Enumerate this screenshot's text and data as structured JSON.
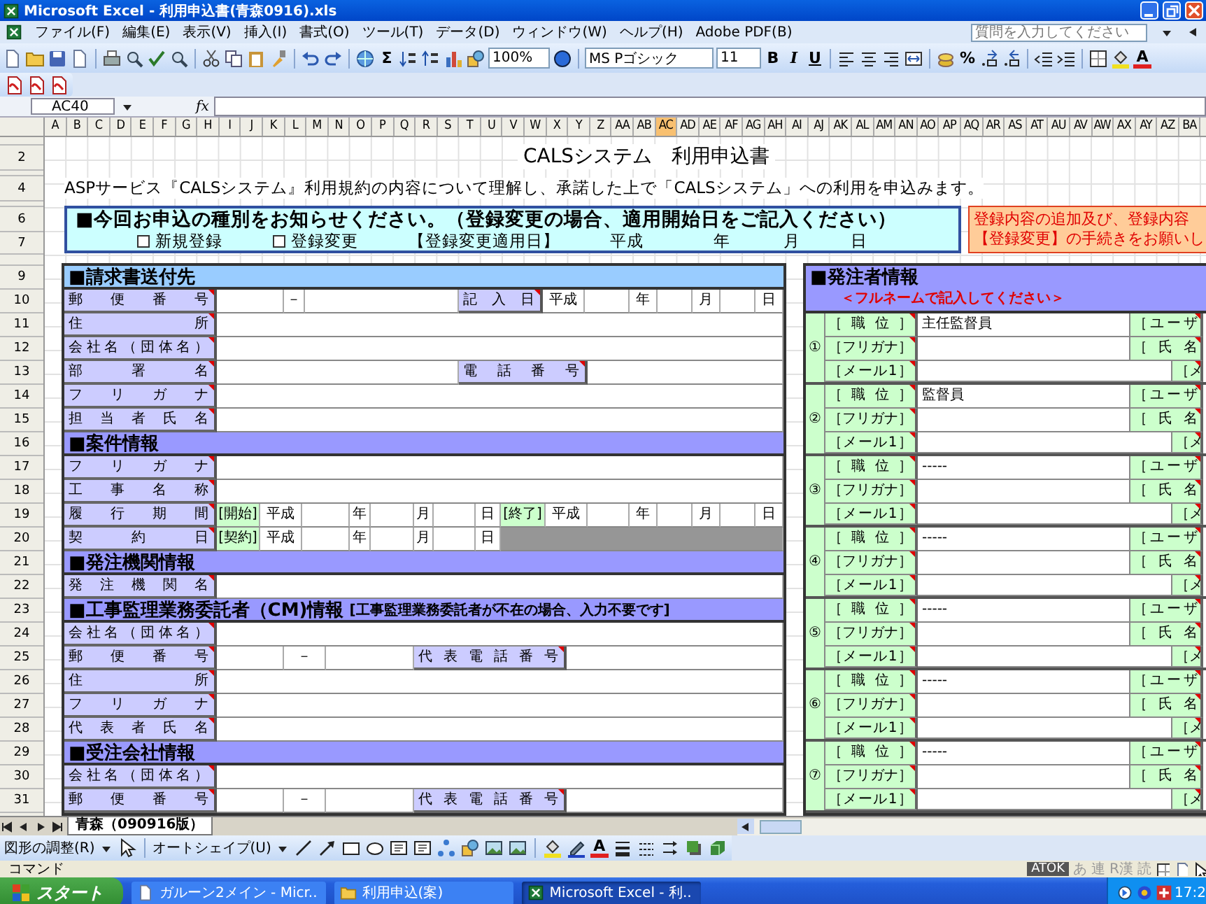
{
  "window": {
    "title": "Microsoft Excel - 利用申込書(青森0916).xls"
  },
  "menu": {
    "items": [
      "ファイル(F)",
      "編集(E)",
      "表示(V)",
      "挿入(I)",
      "書式(O)",
      "ツール(T)",
      "データ(D)",
      "ウィンドウ(W)",
      "ヘルプ(H)",
      "Adobe PDF(B)"
    ],
    "help_search": {
      "placeholder": "質問を入力してください"
    }
  },
  "toolbar": {
    "sum": "Σ",
    "zoom": "100%",
    "font": "MS Pゴシック",
    "font_size": "11",
    "bold": "B",
    "italic": "I",
    "underline": "U",
    "percent": "%",
    "font_color": "A"
  },
  "formula_bar": {
    "name_box": "AC40",
    "fx": "fx"
  },
  "columns": [
    {
      "label": "A",
      "selected": false
    },
    {
      "label": "B",
      "selected": false
    },
    {
      "label": "C",
      "selected": false
    },
    {
      "label": "D",
      "selected": false
    },
    {
      "label": "E",
      "selected": false
    },
    {
      "label": "F",
      "selected": false
    },
    {
      "label": "G",
      "selected": false
    },
    {
      "label": "H",
      "selected": false
    },
    {
      "label": "I",
      "selected": false
    },
    {
      "label": "J",
      "selected": false
    },
    {
      "label": "K",
      "selected": false
    },
    {
      "label": "L",
      "selected": false
    },
    {
      "label": "M",
      "selected": false
    },
    {
      "label": "N",
      "selected": false
    },
    {
      "label": "O",
      "selected": false
    },
    {
      "label": "P",
      "selected": false
    },
    {
      "label": "Q",
      "selected": false
    },
    {
      "label": "R",
      "selected": false
    },
    {
      "label": "S",
      "selected": false
    },
    {
      "label": "T",
      "selected": false
    },
    {
      "label": "U",
      "selected": false
    },
    {
      "label": "V",
      "selected": false
    },
    {
      "label": "W",
      "selected": false
    },
    {
      "label": "X",
      "selected": false
    },
    {
      "label": "Y",
      "selected": false
    },
    {
      "label": "Z",
      "selected": false
    },
    {
      "label": "AA",
      "selected": false
    },
    {
      "label": "AB",
      "selected": false
    },
    {
      "label": "AC",
      "selected": true
    },
    {
      "label": "AD",
      "selected": false
    },
    {
      "label": "AE",
      "selected": false
    },
    {
      "label": "AF",
      "selected": false
    },
    {
      "label": "AG",
      "selected": false
    },
    {
      "label": "AH",
      "selected": false
    },
    {
      "label": "AI",
      "selected": false
    },
    {
      "label": "AJ",
      "selected": false
    },
    {
      "label": "AK",
      "selected": false
    },
    {
      "label": "AL",
      "selected": false
    },
    {
      "label": "AM",
      "selected": false
    },
    {
      "label": "AN",
      "selected": false
    },
    {
      "label": "AO",
      "selected": false
    },
    {
      "label": "AP",
      "selected": false
    },
    {
      "label": "AQ",
      "selected": false
    },
    {
      "label": "AR",
      "selected": false
    },
    {
      "label": "AS",
      "selected": false
    },
    {
      "label": "AT",
      "selected": false
    },
    {
      "label": "AU",
      "selected": false
    },
    {
      "label": "AV",
      "selected": false
    },
    {
      "label": "AW",
      "selected": false
    },
    {
      "label": "AX",
      "selected": false
    },
    {
      "label": "AY",
      "selected": false
    },
    {
      "label": "AZ",
      "selected": false
    },
    {
      "label": "BA",
      "selected": false
    }
  ],
  "row_headers": [
    "2",
    "4",
    "6",
    "7",
    "9",
    "10",
    "11",
    "12",
    "13",
    "14",
    "15",
    "16",
    "17",
    "18",
    "19",
    "20",
    "21",
    "22",
    "23",
    "24",
    "25",
    "26",
    "27",
    "28",
    "29",
    "30",
    "31"
  ],
  "sheet": {
    "title": "CALSシステム　利用申込書",
    "agreement": "ASPサービス『CALSシステム』利用規約の内容について理解し、承諾した上で「CALSシステム」への利用を申込みます。",
    "type_box": {
      "heading": "■今回お申込の種別をお知らせください。（登録変更の場合、適用開始日をご記入ください）",
      "options": [
        {
          "label": "新規登録",
          "checked": false
        },
        {
          "label": "登録変更",
          "checked": false
        }
      ],
      "date_label": "【登録変更適用日】",
      "era": "平成",
      "year": "年",
      "month": "月",
      "day": "日"
    },
    "notice": [
      "登録内容の追加及び、登録内容",
      "【登録変更】の手続きをお願いし"
    ],
    "left_form": [
      {
        "kind": "section",
        "title": "■請求書送付先",
        "color": "#99ccff"
      },
      {
        "kind": "postal_date",
        "cells": [
          "郵便番号",
          "－",
          "記入日",
          "平成",
          "年",
          "月",
          "日"
        ]
      },
      {
        "kind": "field",
        "cells": [
          "住所"
        ]
      },
      {
        "kind": "field",
        "cells": [
          "会社名（団体名）"
        ]
      },
      {
        "kind": "field_phone",
        "cells": [
          "部署名",
          "電話番号"
        ]
      },
      {
        "kind": "field",
        "cells": [
          "フリガナ"
        ]
      },
      {
        "kind": "field",
        "cells": [
          "担当者氏名"
        ]
      },
      {
        "kind": "section",
        "title": "■案件情報",
        "color": "#9999ff"
      },
      {
        "kind": "field",
        "cells": [
          "フリガナ"
        ]
      },
      {
        "kind": "field",
        "cells": [
          "工事名称"
        ]
      },
      {
        "kind": "period",
        "cells": [
          "履行期間",
          "[開始]",
          "平成",
          "年",
          "月",
          "日",
          "[終了]",
          "平成",
          "年",
          "月",
          "日"
        ]
      },
      {
        "kind": "contract",
        "cells": [
          "契約日",
          "[契約]",
          "平成",
          "年",
          "月",
          "日"
        ]
      },
      {
        "kind": "section",
        "title": "■発注機関情報",
        "color": "#9999ff"
      },
      {
        "kind": "field",
        "cells": [
          "発注機関名"
        ]
      },
      {
        "kind": "section",
        "title": "■工事監理業務委託者（CM)情報",
        "note": "[工事監理業務委託者が不在の場合、入力不要です]",
        "color": "#9999ff"
      },
      {
        "kind": "field",
        "cells": [
          "会社名（団体名）"
        ]
      },
      {
        "kind": "postal_phone",
        "cells": [
          "郵便番号",
          "－",
          "代表電話番号"
        ]
      },
      {
        "kind": "field",
        "cells": [
          "住所"
        ]
      },
      {
        "kind": "field",
        "cells": [
          "フリガナ"
        ]
      },
      {
        "kind": "field",
        "cells": [
          "代表者氏名"
        ]
      },
      {
        "kind": "section",
        "title": "■受注会社情報",
        "color": "#9999ff"
      },
      {
        "kind": "field",
        "cells": [
          "会社名（団体名）"
        ]
      },
      {
        "kind": "postal_phone",
        "cells": [
          "郵便番号",
          "－",
          "代表電話番号"
        ]
      }
    ],
    "orderer": {
      "title": "■発注者情報",
      "note": "＜フルネームで記入してください＞",
      "members": [
        {
          "number": "①",
          "position_label": "［職位］",
          "position": "主任監督員",
          "user_label": "［ユーザ",
          "kana_label": "［フリガナ］",
          "name_label": "［氏名",
          "mail_label": "［メール1］",
          "mail2_label": "［メ"
        },
        {
          "number": "②",
          "position_label": "［職位］",
          "position": "監督員",
          "user_label": "［ユーザ",
          "kana_label": "［フリガナ］",
          "name_label": "［氏名",
          "mail_label": "［メール1］",
          "mail2_label": "［メ"
        },
        {
          "number": "③",
          "position_label": "［職位］",
          "position": "-----",
          "user_label": "［ユーザ",
          "kana_label": "［フリガナ］",
          "name_label": "［氏名",
          "mail_label": "［メール1］",
          "mail2_label": "［メ"
        },
        {
          "number": "④",
          "position_label": "［職位］",
          "position": "-----",
          "user_label": "［ユーザ",
          "kana_label": "［フリガナ］",
          "name_label": "［氏名",
          "mail_label": "［メール1］",
          "mail2_label": "［メ"
        },
        {
          "number": "⑤",
          "position_label": "［職位］",
          "position": "-----",
          "user_label": "［ユーザ",
          "kana_label": "［フリガナ］",
          "name_label": "［氏名",
          "mail_label": "［メール1］",
          "mail2_label": "［メ"
        },
        {
          "number": "⑥",
          "position_label": "［職位］",
          "position": "-----",
          "user_label": "［ユーザ",
          "kana_label": "［フリガナ］",
          "name_label": "［氏名",
          "mail_label": "［メール1］",
          "mail2_label": "［メ"
        },
        {
          "number": "⑦",
          "position_label": "［職位］",
          "position": "-----",
          "user_label": "［ユーザ",
          "kana_label": "［フリガナ］",
          "name_label": "［氏名",
          "mail_label": "［メール1］",
          "mail2_label": "［メ"
        }
      ]
    }
  },
  "sheet_tabs": [
    {
      "label": "青森（090916版）",
      "selected": true
    }
  ],
  "drawing_toolbar": {
    "adjust": "図形の調整(R)",
    "autoshape": "オートシェイプ(U)",
    "font_color": "A"
  },
  "status_bar": {
    "mode": "コマンド",
    "ime": "ATOK",
    "ime_modes": [
      "あ",
      "連",
      "R漢",
      "読"
    ]
  },
  "taskbar": {
    "start": "スタート",
    "tasks": [
      {
        "label": "ガルーン2メイン - Micr..",
        "selected": false,
        "kind": "document"
      },
      {
        "label": "利用申込(案)",
        "selected": false,
        "kind": "folder"
      },
      {
        "label": "Microsoft Excel - 利..",
        "selected": true,
        "kind": "spreadsheet"
      }
    ],
    "clock": "17:2"
  }
}
